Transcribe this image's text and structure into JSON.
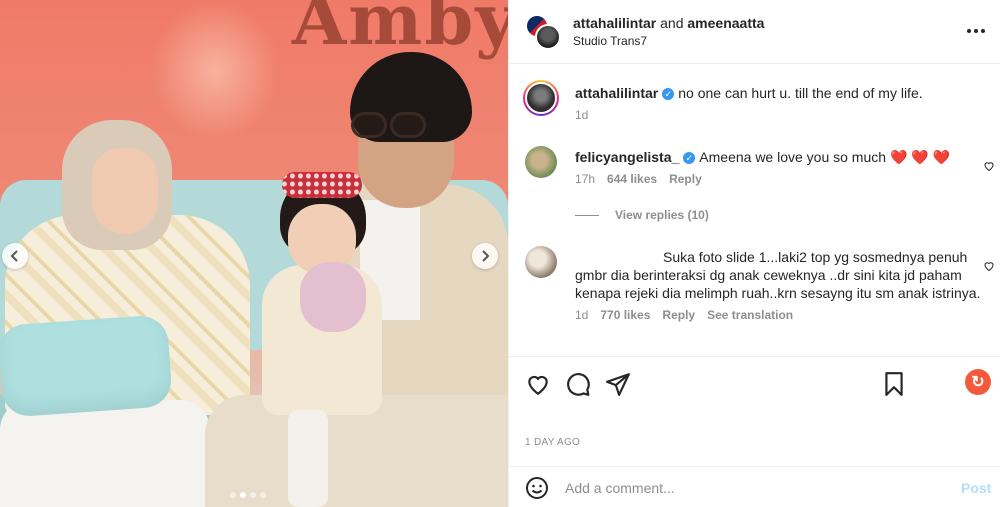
{
  "post": {
    "photo_sign_text": "Ambya",
    "carousel_dot_count": 4,
    "carousel_active_index": 1
  },
  "header": {
    "author_1": "attahalilintar",
    "joiner": "and",
    "author_2": "ameenaatta",
    "location": "Studio Trans7",
    "more_icon": "more-horizontal-icon"
  },
  "comments": [
    {
      "username": "attahalilintar",
      "verified": true,
      "text": "no one can hurt u. till the end of my life.",
      "time": "1d"
    },
    {
      "username": "felicyangelista_",
      "verified": true,
      "text": "Ameena we love you so much",
      "emoji": "❤️ ❤️ ❤️",
      "time": "17h",
      "likes": "644 likes",
      "reply_label": "Reply",
      "view_replies": "View replies (10)"
    },
    {
      "username": "",
      "verified": false,
      "text": "Suka foto slide 1...laki2 top yg sosmednya penuh gmbr dia berinteraksi dg anak ceweknya ..dr sini kita jd paham kenapa rejeki dia melimph ruah..krn sesayng itu sm anak istrinya.",
      "time": "1d",
      "likes": "770 likes",
      "reply_label": "Reply",
      "translation_label": "See translation"
    }
  ],
  "actions": {
    "like_icon": "heart-icon",
    "comment_icon": "comment-icon",
    "share_icon": "send-icon",
    "save_icon": "bookmark-icon",
    "badge_icon": "refresh-icon"
  },
  "timestamp": "1 DAY AGO",
  "composer": {
    "placeholder": "Add a comment...",
    "post_label": "Post",
    "emoji_icon": "emoji-icon"
  },
  "colors": {
    "verified": "#3897f0",
    "heart": "#ed4956",
    "post_disabled": "#b2dffc",
    "muted": "#8e8e8e"
  }
}
